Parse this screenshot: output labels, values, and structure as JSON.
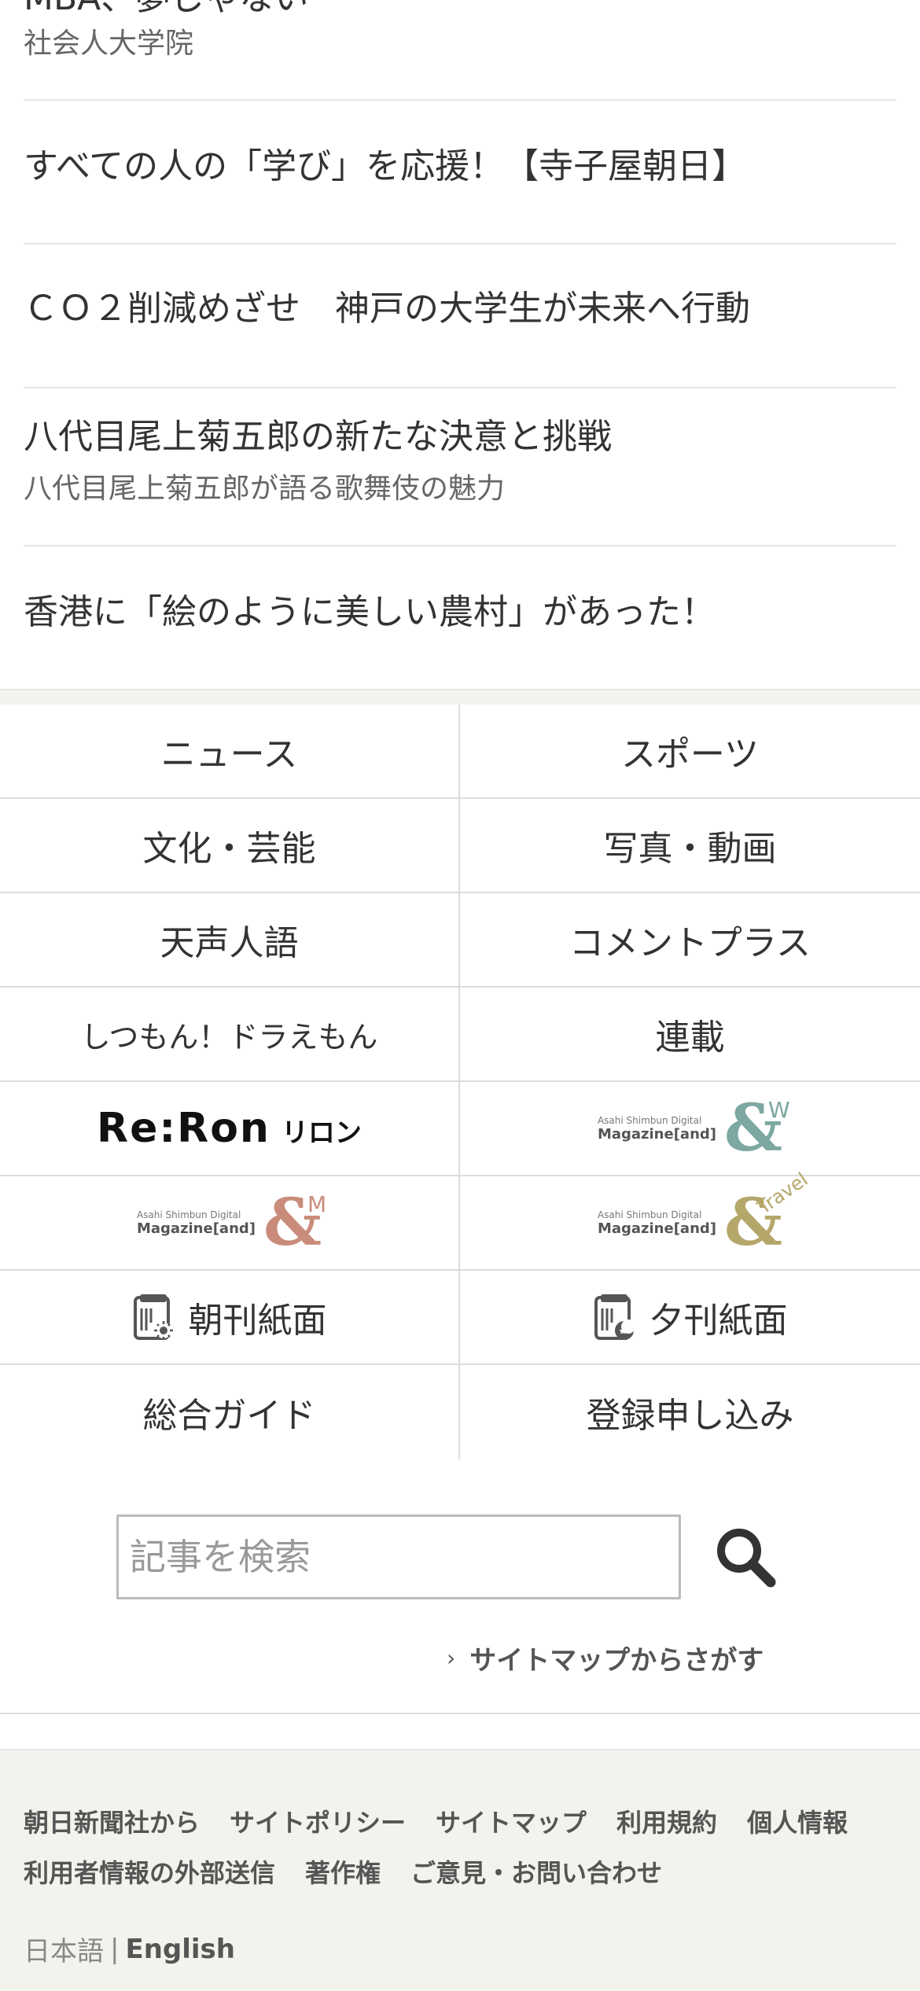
{
  "articles": [
    {
      "title": "MBA、夢じゃない",
      "sub": "社会人大学院"
    },
    {
      "title": "すべての人の「学び」を応援！【寺子屋朝日】"
    },
    {
      "title": "ＣＯ２削減めざせ　神戸の大学生が未来へ行動"
    },
    {
      "title": "八代目尾上菊五郎の新たな決意と挑戦",
      "sub": "八代目尾上菊五郎が語る歌舞伎の魅力"
    },
    {
      "title": "香港に「絵のように美しい農村」があった！"
    }
  ],
  "nav": {
    "news": "ニュース",
    "sports": "スポーツ",
    "culture": "文化・芸能",
    "photo": "写真・動画",
    "tensei": "天声人語",
    "comment": "コメントプラス",
    "doraemon": "しつもん！ドラえもん",
    "series": "連載",
    "reron": {
      "big": "Re:Ron",
      "kana": "リロン"
    },
    "mag_brand": "Asahi Shimbun Digital",
    "mag_name": "Magazine[and]",
    "and_w": "W",
    "and_m": "M",
    "and_travel": "Travel",
    "morning": "朝刊紙面",
    "evening": "夕刊紙面",
    "guide": "総合ガイド",
    "signup": "登録申し込み"
  },
  "search": {
    "placeholder": "記事を検索",
    "sitemap_link": "サイトマップからさがす"
  },
  "footer": {
    "links_row1": [
      "朝日新聞社から",
      "サイトポリシー",
      "サイトマップ",
      "利用規約",
      "個人情報"
    ],
    "links_row2": [
      "利用者情報の外部送信",
      "著作権",
      "ご意見・お問い合わせ"
    ],
    "lang_ja": "日本語",
    "lang_sep": "|",
    "lang_en": "English"
  },
  "colors": {
    "band": "#f3f2ec",
    "and_w": "#7da7a1",
    "and_m": "#c98c7a",
    "and_travel": "#b5a66a"
  }
}
